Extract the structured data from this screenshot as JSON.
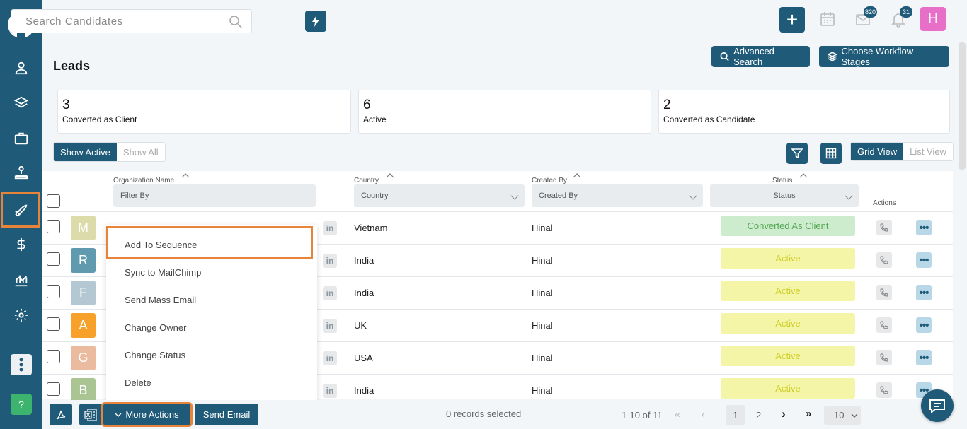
{
  "search": {
    "placeholder": "Search Candidates"
  },
  "header": {
    "mail_badge": "820",
    "notif_badge": "31",
    "user_initial": "H",
    "page_title": "Leads",
    "advanced_search": "Advanced Search",
    "workflow_stages": "Choose Workflow Stages"
  },
  "stats": [
    {
      "count": "3",
      "label": "Converted as Client"
    },
    {
      "count": "6",
      "label": "Active"
    },
    {
      "count": "2",
      "label": "Converted as Candidate"
    }
  ],
  "filters": {
    "show_active": "Show Active",
    "show_all": "Show All",
    "grid_view": "Grid View",
    "list_view": "List View"
  },
  "columns": {
    "organization": "Organization Name",
    "organization_placeholder": "Filter By",
    "country": "Country",
    "country_select": "Country",
    "created_by": "Created By",
    "created_by_select": "Created By",
    "status": "Status",
    "status_select": "Status",
    "actions": "Actions"
  },
  "rows": [
    {
      "initial": "M",
      "avatar_color": "#dcdcab",
      "country": "Vietnam",
      "created_by": "Hinal",
      "status": "Converted As Client"
    },
    {
      "initial": "R",
      "avatar_color": "#5f9aae",
      "country": "India",
      "created_by": "Hinal",
      "status": "Active"
    },
    {
      "initial": "F",
      "avatar_color": "#b3c8d3",
      "country": "India",
      "created_by": "Hinal",
      "status": "Active"
    },
    {
      "initial": "A",
      "avatar_color": "#f7a12a",
      "country": "UK",
      "created_by": "Hinal",
      "status": "Active"
    },
    {
      "initial": "G",
      "avatar_color": "#ebbba0",
      "country": "USA",
      "created_by": "Hinal",
      "status": "Active"
    },
    {
      "initial": "B",
      "avatar_color": "#aac494",
      "country": "India",
      "created_by": "Hinal",
      "status": "Active"
    }
  ],
  "linkedin_glyph": "in",
  "menu": {
    "items": [
      "Add To Sequence",
      "Sync to MailChimp",
      "Send Mass Email",
      "Change Owner",
      "Change Status",
      "Delete"
    ]
  },
  "bottom": {
    "more_actions": "More Actions",
    "send_email": "Send Email",
    "records_selected": "0 records selected",
    "range": "1-10 of 11",
    "page_current": "1",
    "page_next": "2",
    "page_size": "10"
  },
  "help_label": "?",
  "colors": {
    "primary": "#1f5a78",
    "highlight": "#e8833a"
  }
}
